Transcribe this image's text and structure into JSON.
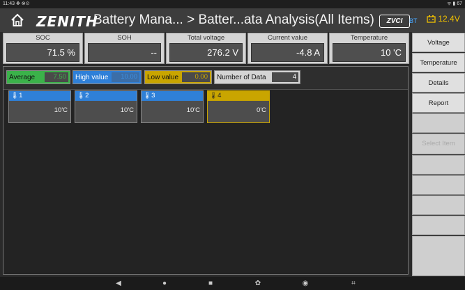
{
  "status_bar": {
    "time": "11:43",
    "left_icons": "✥ ⊗⊙",
    "right_icons": "ᯤ ▮ 67"
  },
  "header": {
    "brand": "ZENITH",
    "title": "Battery Mana... > Batter...ata Analysis(All Items)",
    "zvci_label": "ZVCI",
    "bt_label": "BT",
    "battery_voltage": "12.4V"
  },
  "metrics": [
    {
      "label": "SOC",
      "value": "71.5 %"
    },
    {
      "label": "SOH",
      "value": "--"
    },
    {
      "label": "Total voltage",
      "value": "276.2 V"
    },
    {
      "label": "Current value",
      "value": "-4.8 A"
    },
    {
      "label": "Temperature",
      "value": "10 'C"
    }
  ],
  "summary": {
    "average_label": "Average",
    "average_value": "7.50",
    "high_label": "High value",
    "high_value": "10.00",
    "low_label": "Low value",
    "low_value": "0.00",
    "count_label": "Number of Data",
    "count_value": "4"
  },
  "cells": [
    {
      "index": "1",
      "temp": "10'C",
      "color": "blue"
    },
    {
      "index": "2",
      "temp": "10'C",
      "color": "blue"
    },
    {
      "index": "3",
      "temp": "10'C",
      "color": "blue"
    },
    {
      "index": "4",
      "temp": "0'C",
      "color": "gold"
    }
  ],
  "side_buttons": [
    "Voltage",
    "Temperature",
    "Details",
    "Report",
    "",
    "Select Item",
    "",
    "",
    "",
    "",
    ""
  ],
  "colors": {
    "blue": "#2f80d8",
    "gold": "#c9a500",
    "green": "#3bb24a"
  }
}
